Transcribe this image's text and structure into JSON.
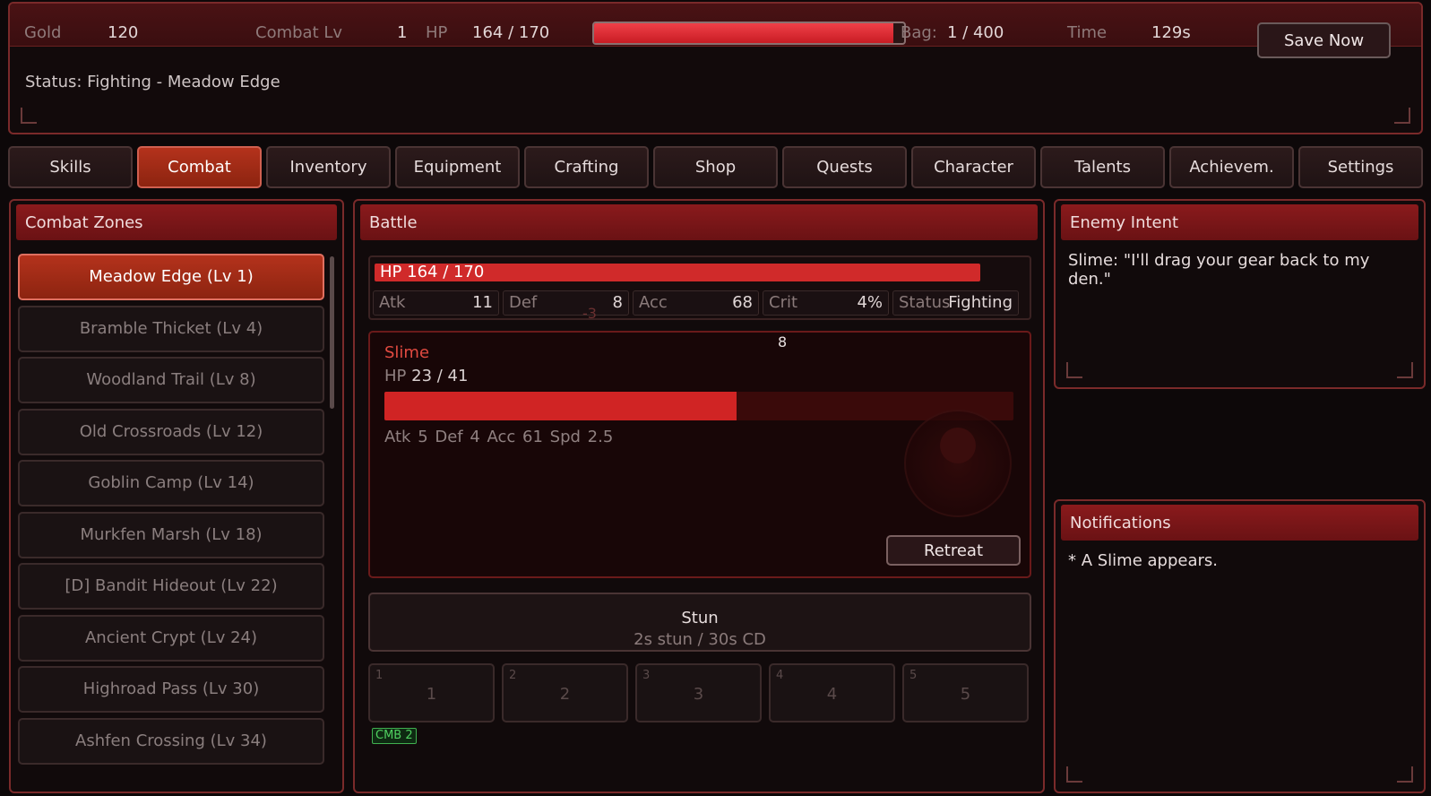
{
  "topbar": {
    "gold_label": "Gold",
    "gold_value": "120",
    "combat_label": "Combat Lv",
    "combat_value": "1",
    "hp_label": "HP",
    "hp_value": "164 / 170",
    "hp_fraction": 0.965,
    "bag_label": "Bag:",
    "bag_value": "1 / 400",
    "time_label": "Time",
    "time_value": "129s",
    "save_label": "Save Now"
  },
  "status": "Status: Fighting - Meadow Edge",
  "tabs": [
    "Skills",
    "Combat",
    "Inventory",
    "Equipment",
    "Crafting",
    "Shop",
    "Quests",
    "Character",
    "Talents",
    "Achievem.",
    "Settings"
  ],
  "active_tab": "Combat",
  "zones_panel": {
    "title": "Combat Zones",
    "zones": [
      "Meadow Edge  (Lv 1)",
      "Bramble Thicket  (Lv 4)",
      "Woodland Trail  (Lv 8)",
      "Old Crossroads  (Lv 12)",
      "Goblin Camp  (Lv 14)",
      "Murkfen Marsh  (Lv 18)",
      "[D] Bandit Hideout  (Lv 22)",
      "Ancient Crypt  (Lv 24)",
      "Highroad Pass  (Lv 30)",
      "Ashfen Crossing  (Lv 34)"
    ]
  },
  "battle": {
    "title": "Battle",
    "player_hp": "HP  164 / 170",
    "player_hp_fraction": 0.965,
    "stats": [
      {
        "label": "Atk",
        "value": "11"
      },
      {
        "label": "Def",
        "value": "8"
      },
      {
        "label": "Acc",
        "value": "68"
      },
      {
        "label": "Crit",
        "value": "4%"
      },
      {
        "label": "Status",
        "value": "Fighting"
      }
    ],
    "float_number": "8",
    "float_damage": "-3",
    "enemy": {
      "name": "Slime",
      "hp_label": "HP",
      "hp_value": "23 / 41",
      "hp_fraction": 0.56,
      "stats": "Atk 5   Def 4   Acc 61   Spd 2.5"
    },
    "retreat_label": "Retreat",
    "skill": {
      "name": "Stun",
      "desc": "2s stun / 30s CD"
    },
    "slots": [
      {
        "key": "1",
        "label": "1"
      },
      {
        "key": "2",
        "label": "2"
      },
      {
        "key": "3",
        "label": "3"
      },
      {
        "key": "4",
        "label": "4"
      },
      {
        "key": "5",
        "label": "5"
      }
    ],
    "combo_badge": "CMB 2"
  },
  "intent_panel": {
    "title": "Enemy Intent",
    "text": "Slime: \"I'll drag your gear back to my den.\""
  },
  "notifications_panel": {
    "title": "Notifications",
    "items": [
      "* A Slime appears."
    ]
  }
}
